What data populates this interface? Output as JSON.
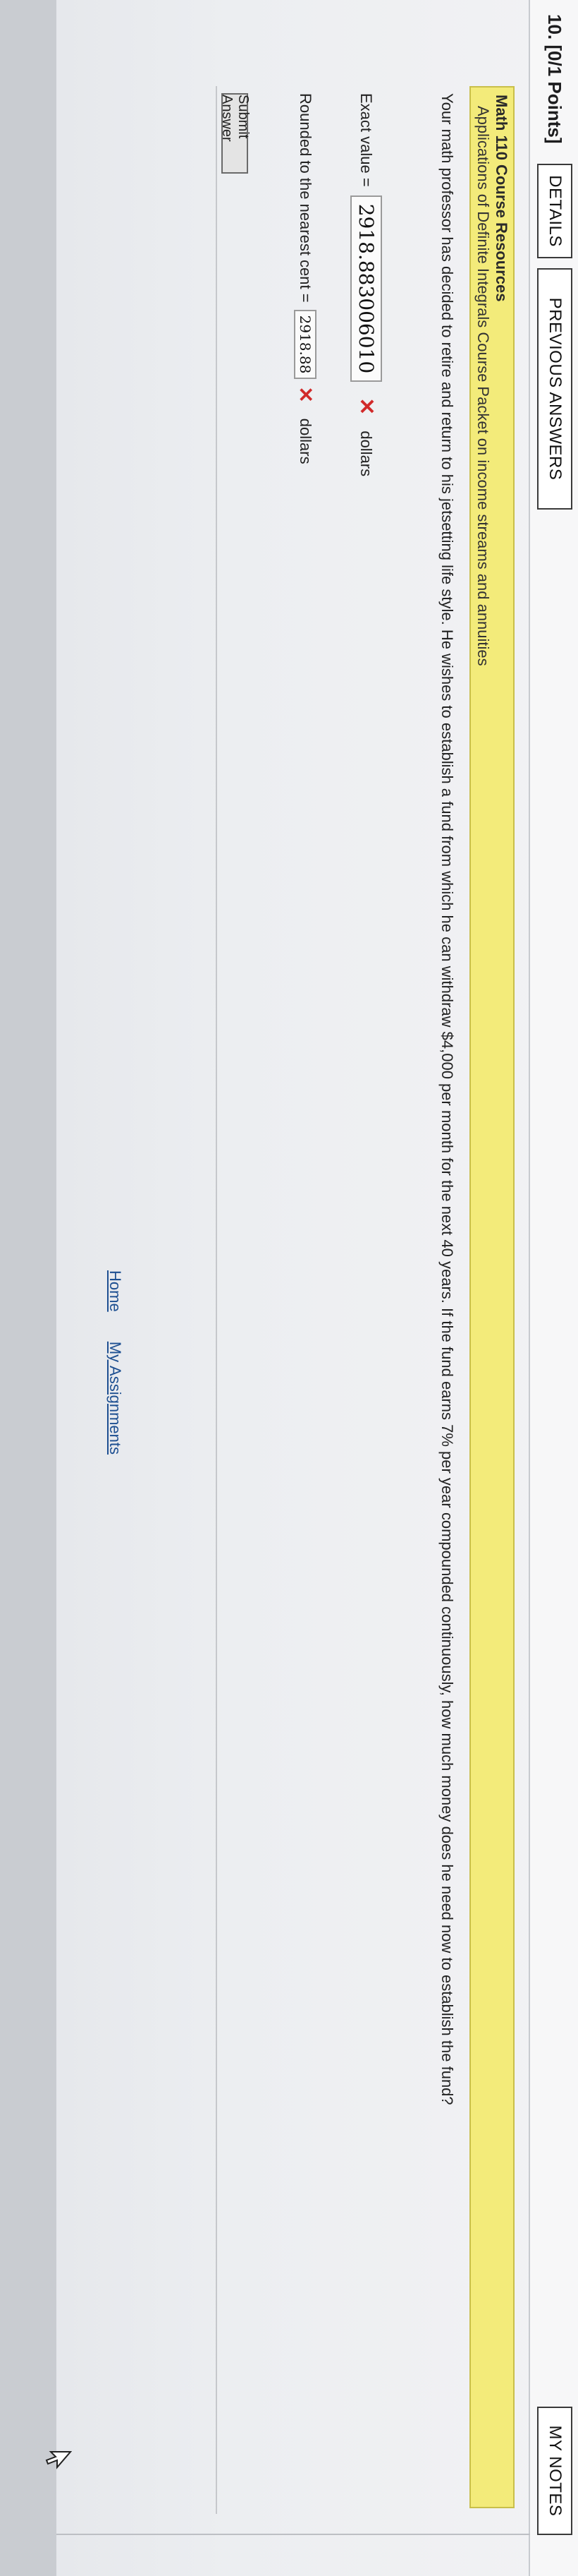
{
  "header": {
    "question_number": "10.",
    "points": "[0/1 Points]",
    "details_label": "DETAILS",
    "previous_answers_label": "PREVIOUS ANSWERS",
    "my_notes_label": "MY NOTES"
  },
  "resources": {
    "title": "Math 110 Course Resources",
    "link_text": "Applications of Definite Integrals Course Packet on income streams and annuities"
  },
  "question": {
    "text": "Your math professor has decided to retire and return to his jetsetting life style. He wishes to establish a fund from which he can withdraw $4,000 per month for the next 40 years. If the fund earns 7% per year compounded continuously, how much money does he need now to establish the fund?"
  },
  "answers": {
    "exact_label": "Exact value =",
    "exact_value": "2918.883006010",
    "exact_unit": "dollars",
    "rounded_label": "Rounded to the nearest cent =",
    "rounded_value": "2918.88",
    "rounded_unit": "dollars",
    "status": "incorrect"
  },
  "submit_label": "Submit Answer",
  "footer": {
    "home_label": "Home",
    "assignments_label": "My Assignments"
  },
  "icons": {
    "wrong": "x-mark-icon",
    "cursor": "mouse-pointer-icon"
  },
  "colors": {
    "resource_bg": "#f3eb7a",
    "wrong_mark": "#d12a2a",
    "link": "#1d4f91"
  }
}
